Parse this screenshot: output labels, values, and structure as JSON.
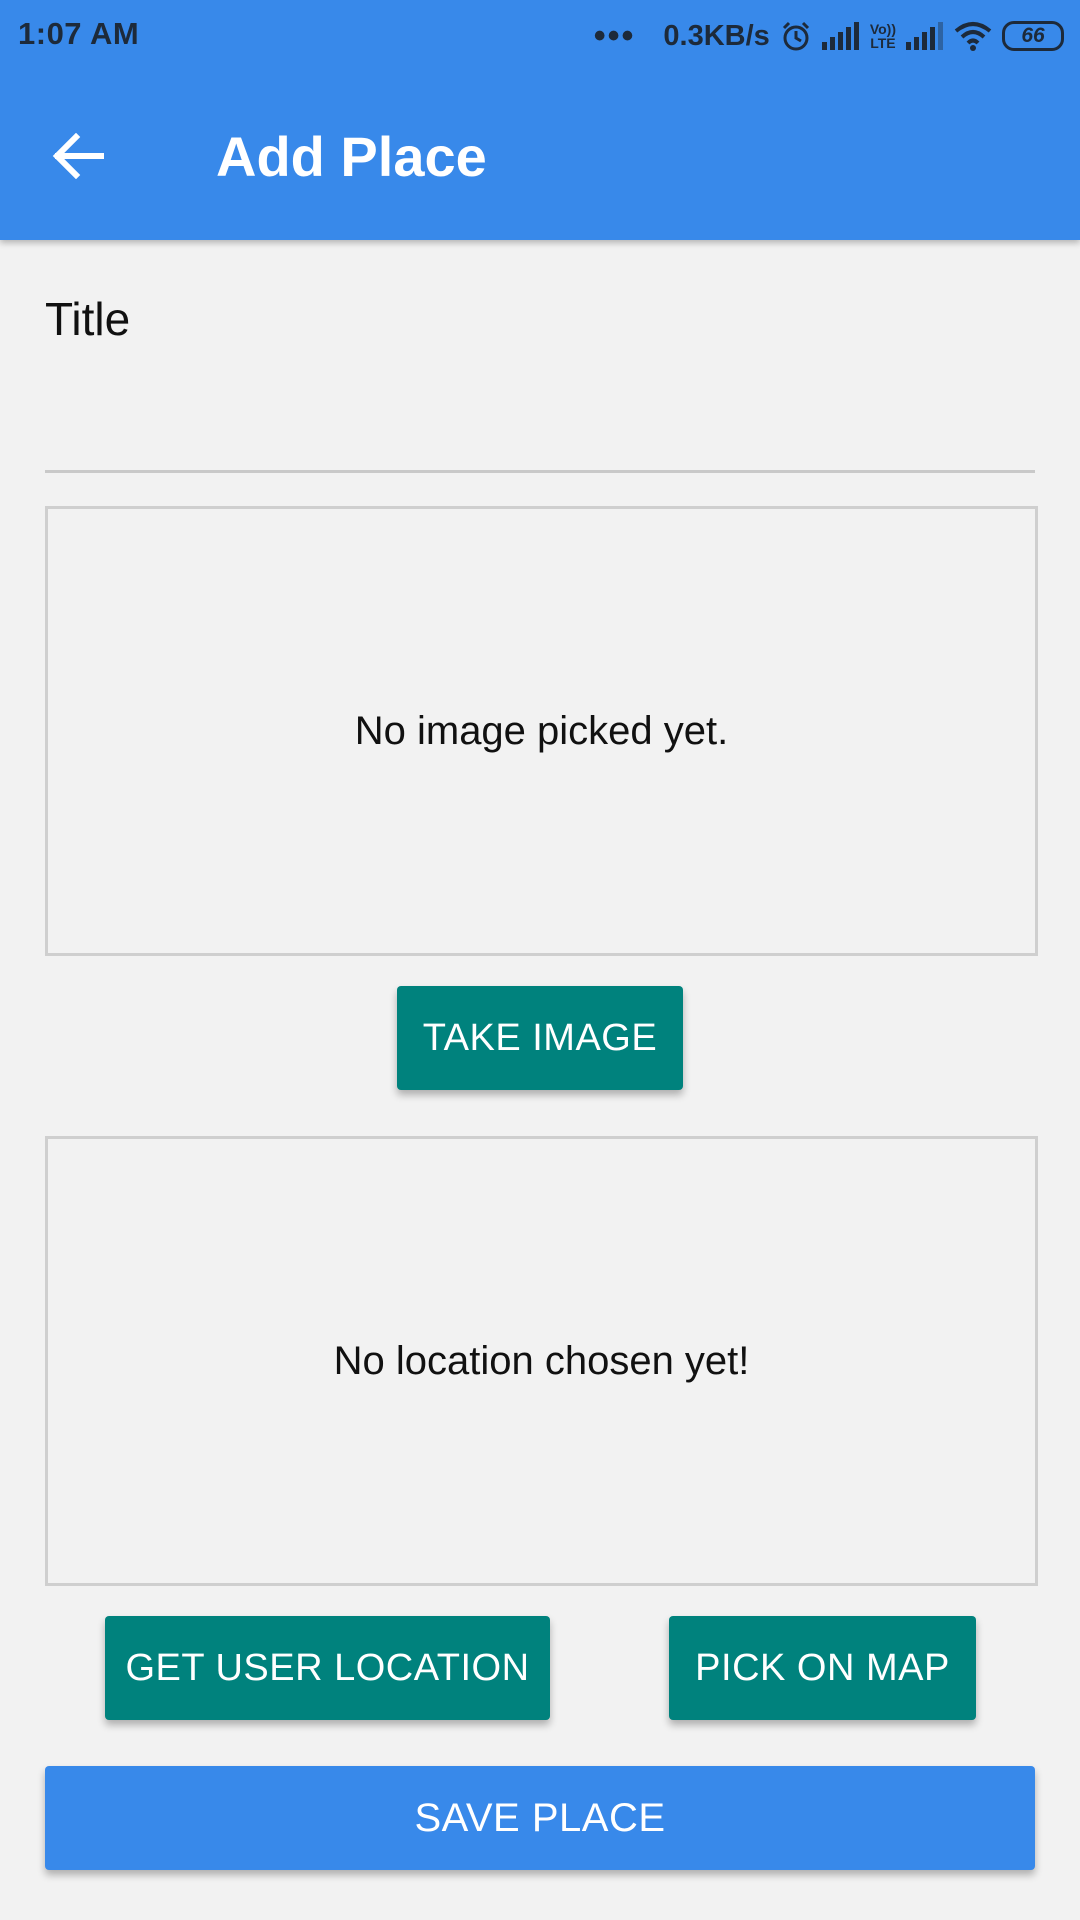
{
  "status_bar": {
    "time": "1:07 AM",
    "speed": "0.3KB/s",
    "battery": "66",
    "lte_top": "Vo))",
    "lte_bottom": "LTE",
    "icons": [
      "more-dots-icon",
      "alarm-icon",
      "signal-icon",
      "lte-icon",
      "signal-icon",
      "wifi-icon",
      "battery-icon"
    ]
  },
  "app_bar": {
    "title": "Add Place",
    "back_icon": "arrow-back-icon"
  },
  "form": {
    "title_label": "Title",
    "title_value": "",
    "image_placeholder": "No image picked yet.",
    "take_image_label": "TAKE IMAGE",
    "location_placeholder": "No location chosen yet!",
    "get_location_label": "GET USER LOCATION",
    "pick_map_label": "PICK ON MAP",
    "save_label": "SAVE PLACE"
  },
  "colors": {
    "primary": "#3889ea",
    "accent": "#00827d",
    "background": "#f2f2f2"
  }
}
